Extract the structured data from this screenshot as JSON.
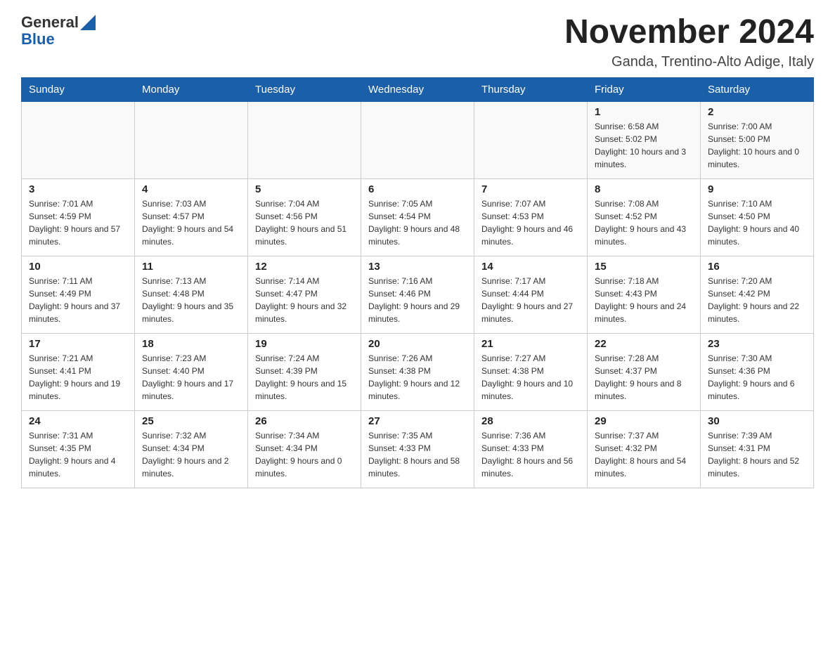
{
  "logo": {
    "general": "General",
    "blue": "Blue"
  },
  "title": "November 2024",
  "subtitle": "Ganda, Trentino-Alto Adige, Italy",
  "days_of_week": [
    "Sunday",
    "Monday",
    "Tuesday",
    "Wednesday",
    "Thursday",
    "Friday",
    "Saturday"
  ],
  "weeks": [
    [
      {
        "day": "",
        "info": ""
      },
      {
        "day": "",
        "info": ""
      },
      {
        "day": "",
        "info": ""
      },
      {
        "day": "",
        "info": ""
      },
      {
        "day": "",
        "info": ""
      },
      {
        "day": "1",
        "info": "Sunrise: 6:58 AM\nSunset: 5:02 PM\nDaylight: 10 hours and 3 minutes."
      },
      {
        "day": "2",
        "info": "Sunrise: 7:00 AM\nSunset: 5:00 PM\nDaylight: 10 hours and 0 minutes."
      }
    ],
    [
      {
        "day": "3",
        "info": "Sunrise: 7:01 AM\nSunset: 4:59 PM\nDaylight: 9 hours and 57 minutes."
      },
      {
        "day": "4",
        "info": "Sunrise: 7:03 AM\nSunset: 4:57 PM\nDaylight: 9 hours and 54 minutes."
      },
      {
        "day": "5",
        "info": "Sunrise: 7:04 AM\nSunset: 4:56 PM\nDaylight: 9 hours and 51 minutes."
      },
      {
        "day": "6",
        "info": "Sunrise: 7:05 AM\nSunset: 4:54 PM\nDaylight: 9 hours and 48 minutes."
      },
      {
        "day": "7",
        "info": "Sunrise: 7:07 AM\nSunset: 4:53 PM\nDaylight: 9 hours and 46 minutes."
      },
      {
        "day": "8",
        "info": "Sunrise: 7:08 AM\nSunset: 4:52 PM\nDaylight: 9 hours and 43 minutes."
      },
      {
        "day": "9",
        "info": "Sunrise: 7:10 AM\nSunset: 4:50 PM\nDaylight: 9 hours and 40 minutes."
      }
    ],
    [
      {
        "day": "10",
        "info": "Sunrise: 7:11 AM\nSunset: 4:49 PM\nDaylight: 9 hours and 37 minutes."
      },
      {
        "day": "11",
        "info": "Sunrise: 7:13 AM\nSunset: 4:48 PM\nDaylight: 9 hours and 35 minutes."
      },
      {
        "day": "12",
        "info": "Sunrise: 7:14 AM\nSunset: 4:47 PM\nDaylight: 9 hours and 32 minutes."
      },
      {
        "day": "13",
        "info": "Sunrise: 7:16 AM\nSunset: 4:46 PM\nDaylight: 9 hours and 29 minutes."
      },
      {
        "day": "14",
        "info": "Sunrise: 7:17 AM\nSunset: 4:44 PM\nDaylight: 9 hours and 27 minutes."
      },
      {
        "day": "15",
        "info": "Sunrise: 7:18 AM\nSunset: 4:43 PM\nDaylight: 9 hours and 24 minutes."
      },
      {
        "day": "16",
        "info": "Sunrise: 7:20 AM\nSunset: 4:42 PM\nDaylight: 9 hours and 22 minutes."
      }
    ],
    [
      {
        "day": "17",
        "info": "Sunrise: 7:21 AM\nSunset: 4:41 PM\nDaylight: 9 hours and 19 minutes."
      },
      {
        "day": "18",
        "info": "Sunrise: 7:23 AM\nSunset: 4:40 PM\nDaylight: 9 hours and 17 minutes."
      },
      {
        "day": "19",
        "info": "Sunrise: 7:24 AM\nSunset: 4:39 PM\nDaylight: 9 hours and 15 minutes."
      },
      {
        "day": "20",
        "info": "Sunrise: 7:26 AM\nSunset: 4:38 PM\nDaylight: 9 hours and 12 minutes."
      },
      {
        "day": "21",
        "info": "Sunrise: 7:27 AM\nSunset: 4:38 PM\nDaylight: 9 hours and 10 minutes."
      },
      {
        "day": "22",
        "info": "Sunrise: 7:28 AM\nSunset: 4:37 PM\nDaylight: 9 hours and 8 minutes."
      },
      {
        "day": "23",
        "info": "Sunrise: 7:30 AM\nSunset: 4:36 PM\nDaylight: 9 hours and 6 minutes."
      }
    ],
    [
      {
        "day": "24",
        "info": "Sunrise: 7:31 AM\nSunset: 4:35 PM\nDaylight: 9 hours and 4 minutes."
      },
      {
        "day": "25",
        "info": "Sunrise: 7:32 AM\nSunset: 4:34 PM\nDaylight: 9 hours and 2 minutes."
      },
      {
        "day": "26",
        "info": "Sunrise: 7:34 AM\nSunset: 4:34 PM\nDaylight: 9 hours and 0 minutes."
      },
      {
        "day": "27",
        "info": "Sunrise: 7:35 AM\nSunset: 4:33 PM\nDaylight: 8 hours and 58 minutes."
      },
      {
        "day": "28",
        "info": "Sunrise: 7:36 AM\nSunset: 4:33 PM\nDaylight: 8 hours and 56 minutes."
      },
      {
        "day": "29",
        "info": "Sunrise: 7:37 AM\nSunset: 4:32 PM\nDaylight: 8 hours and 54 minutes."
      },
      {
        "day": "30",
        "info": "Sunrise: 7:39 AM\nSunset: 4:31 PM\nDaylight: 8 hours and 52 minutes."
      }
    ]
  ]
}
